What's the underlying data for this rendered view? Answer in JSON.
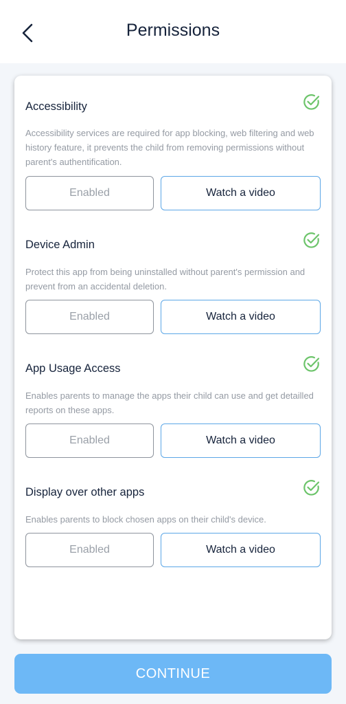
{
  "header": {
    "title": "Permissions"
  },
  "permissions": [
    {
      "title": "Accessibility",
      "description": "Accessibility services are required for app blocking, web filtering and web history feature, it prevents the child from removing permissions without parent's authentification.",
      "status_label": "Enabled",
      "video_label": "Watch a video",
      "granted": true
    },
    {
      "title": "Device Admin",
      "description": "Protect this app from being uninstalled without parent's permission and prevent from an accidental deletion.",
      "status_label": "Enabled",
      "video_label": "Watch a video",
      "granted": true
    },
    {
      "title": "App Usage Access",
      "description": "Enables parents to manage the apps their child can use and get detailled reports on these apps.",
      "status_label": "Enabled",
      "video_label": "Watch a video",
      "granted": true
    },
    {
      "title": "Display over other apps",
      "description": "Enables parents to block chosen apps on their child's device.",
      "status_label": "Enabled",
      "video_label": "Watch a video",
      "granted": true
    }
  ],
  "continue_label": "CONTINUE",
  "icons": {
    "back": "chevron-left-icon",
    "granted": "check-circle-icon"
  },
  "colors": {
    "accent": "#6db8f6",
    "check": "#6cc46a",
    "video_border": "#5ba6e6",
    "title": "#16233b",
    "muted": "#949aa3"
  }
}
